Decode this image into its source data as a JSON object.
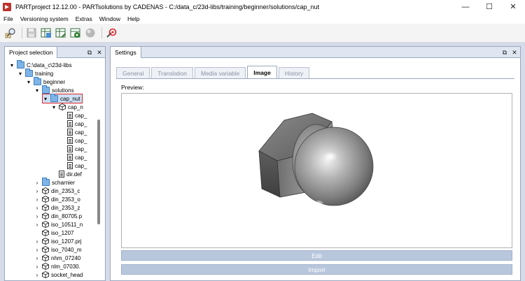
{
  "window": {
    "title": "PARTproject 12.12.00 - PARTsolutions by CADENAS - C:/data_c/23d-libs/training/beginner/solutions/cap_nut",
    "minimize": "—",
    "maximize": "☐",
    "close": "✕"
  },
  "menu": [
    "File",
    "Versioning system",
    "Extras",
    "Window",
    "Help"
  ],
  "toolbar": {
    "icons": [
      "search-icon",
      "save-icon",
      "table-export-icon",
      "table-view-icon",
      "table-settings-icon",
      "sphere-icon",
      "wrench-refresh-icon"
    ]
  },
  "project_panel": {
    "title": "Project selection",
    "tree": [
      {
        "label": "C:\\data_c\\23d-libs",
        "type": "folder",
        "toggle": "▾"
      },
      {
        "label": "training",
        "type": "folder",
        "toggle": "▾"
      },
      {
        "label": "beginner",
        "type": "folder",
        "toggle": "▾"
      },
      {
        "label": "solutions",
        "type": "folder",
        "toggle": "▾"
      },
      {
        "label": "cap_nut",
        "type": "folder",
        "toggle": "▾",
        "selected": true
      },
      {
        "label": "cap_n",
        "type": "cube",
        "toggle": "▾"
      },
      {
        "label": "cap_",
        "type": "file"
      },
      {
        "label": "cap_",
        "type": "file"
      },
      {
        "label": "cap_",
        "type": "file"
      },
      {
        "label": "cap_",
        "type": "file"
      },
      {
        "label": "cap_",
        "type": "file"
      },
      {
        "label": "cap_",
        "type": "file"
      },
      {
        "label": "cap_",
        "type": "file"
      },
      {
        "label": "dir.def",
        "type": "file"
      },
      {
        "label": "scharnier",
        "type": "folder",
        "toggle": "›"
      },
      {
        "label": "din_2353_c",
        "type": "cube",
        "toggle": "›"
      },
      {
        "label": "din_2353_o",
        "type": "cube",
        "toggle": "›"
      },
      {
        "label": "din_2353_z",
        "type": "cube",
        "toggle": "›"
      },
      {
        "label": "din_80705.p",
        "type": "cube",
        "toggle": "›"
      },
      {
        "label": "iso_10511_n",
        "type": "cube",
        "toggle": "›"
      },
      {
        "label": "iso_1207",
        "type": "cube",
        "toggle": ""
      },
      {
        "label": "iso_1207.prj",
        "type": "cube",
        "toggle": "›"
      },
      {
        "label": "iso_7040_m",
        "type": "cube",
        "toggle": "›"
      },
      {
        "label": "nhm_07240",
        "type": "cube",
        "toggle": "›"
      },
      {
        "label": "nlm_07030.",
        "type": "cube",
        "toggle": "›"
      },
      {
        "label": "socket_head",
        "type": "cube",
        "toggle": "›"
      }
    ]
  },
  "settings_panel": {
    "title": "Settings",
    "tabs": [
      {
        "label": "General",
        "active": false
      },
      {
        "label": "Translation",
        "active": false
      },
      {
        "label": "Media variable",
        "active": false
      },
      {
        "label": "Image",
        "active": true
      },
      {
        "label": "History",
        "active": false
      }
    ],
    "preview_label": "Preview:",
    "edit_button": "Edit",
    "import_button": "Import",
    "preview_image": "cap-nut-3d-render"
  },
  "colors": {
    "workspace_bg": "#d6dbe9",
    "panel_header": "#dfe6f1",
    "button_bg": "#b9c7dd",
    "selection_outline": "#d9232a"
  }
}
